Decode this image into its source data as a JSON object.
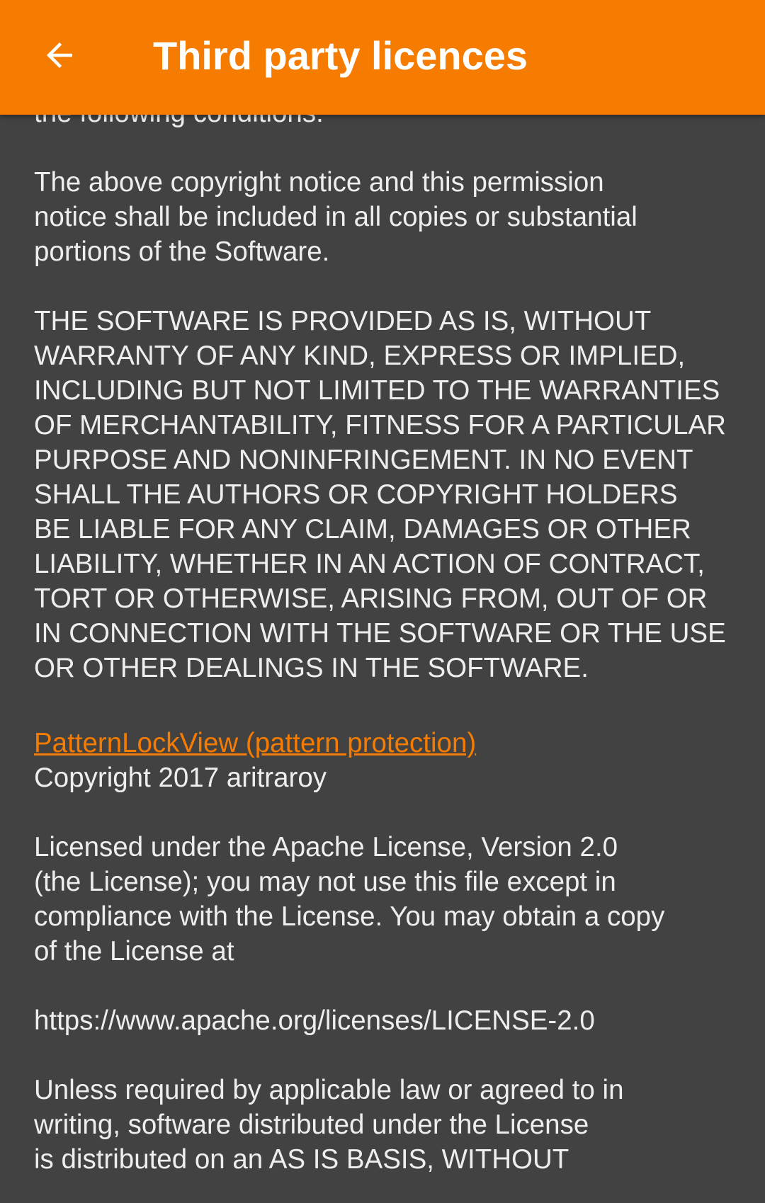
{
  "toolbar": {
    "back_icon": "arrow-back-icon",
    "title": "Third party licences",
    "background_color": "#f57c00"
  },
  "mit_text": {
    "intro_tail": "the following conditions:",
    "notice": [
      "The above copyright notice and this permission",
      "notice shall be included in all copies or substantial",
      "portions of the Software."
    ],
    "disclaimer": [
      "THE SOFTWARE IS PROVIDED AS IS, WITHOUT",
      "WARRANTY OF ANY KIND, EXPRESS OR IMPLIED,",
      "INCLUDING BUT NOT LIMITED TO THE WARRANTIES",
      "OF MERCHANTABILITY, FITNESS FOR A PARTICULAR",
      "PURPOSE AND NONINFRINGEMENT. IN NO EVENT",
      "SHALL THE AUTHORS OR COPYRIGHT HOLDERS",
      "BE LIABLE FOR ANY CLAIM, DAMAGES OR OTHER",
      "LIABILITY, WHETHER IN AN ACTION OF CONTRACT,",
      "TORT OR OTHERWISE, ARISING FROM, OUT OF OR",
      "IN CONNECTION WITH THE SOFTWARE OR THE USE",
      "OR OTHER DEALINGS IN THE SOFTWARE."
    ]
  },
  "library": {
    "name": "PatternLockView (pattern protection)",
    "link_color": "#f57c00",
    "copyright": "Copyright 2017 aritraroy",
    "license_intro": [
      "Licensed under the Apache License, Version 2.0",
      "(the License); you may not use this file except in",
      "compliance with the License. You may obtain a copy",
      "of the License at"
    ],
    "license_url": "https://www.apache.org/licenses/LICENSE-2.0",
    "license_terms": [
      "Unless required by applicable law or agreed to in",
      "writing, software distributed under the License",
      "is distributed on an AS IS BASIS, WITHOUT"
    ]
  }
}
